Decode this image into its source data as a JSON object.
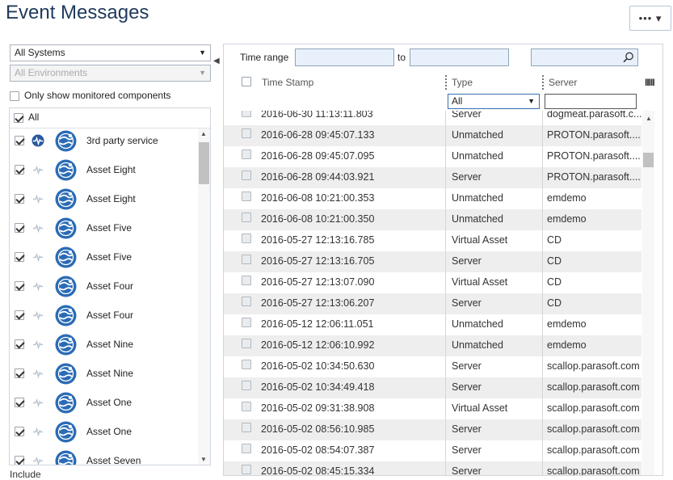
{
  "page": {
    "title": "Event Messages",
    "menu_label": "••• ▾"
  },
  "filters": {
    "systems": "All Systems",
    "environments": "All Environments",
    "only_monitored_label": "Only show monitored components"
  },
  "components": {
    "all_label": "All",
    "items": [
      {
        "label": "3rd party service",
        "checked": true,
        "active": true
      },
      {
        "label": "Asset Eight",
        "checked": true,
        "active": false
      },
      {
        "label": "Asset Eight",
        "checked": true,
        "active": false
      },
      {
        "label": "Asset Five",
        "checked": true,
        "active": false
      },
      {
        "label": "Asset Five",
        "checked": true,
        "active": false
      },
      {
        "label": "Asset Four",
        "checked": true,
        "active": false
      },
      {
        "label": "Asset Four",
        "checked": true,
        "active": false
      },
      {
        "label": "Asset Nine",
        "checked": true,
        "active": false
      },
      {
        "label": "Asset Nine",
        "checked": true,
        "active": false
      },
      {
        "label": "Asset One",
        "checked": true,
        "active": false
      },
      {
        "label": "Asset One",
        "checked": true,
        "active": false
      },
      {
        "label": "Asset Seven",
        "checked": true,
        "active": false
      }
    ],
    "include_label": "Include"
  },
  "time_range": {
    "label": "Time range",
    "to_label": "to",
    "from_value": "",
    "to_value": "",
    "search_value": ""
  },
  "grid": {
    "headers": {
      "timestamp": "Time Stamp",
      "type": "Type",
      "server": "Server"
    },
    "type_filter": "All",
    "server_filter": "",
    "columns_icon": "IIIII",
    "rows": [
      {
        "timestamp": "2016-06-30 11:13:11.803",
        "type": "Server",
        "server": "dogmeat.parasoft.c..."
      },
      {
        "timestamp": "2016-06-28 09:45:07.133",
        "type": "Unmatched",
        "server": "PROTON.parasoft...."
      },
      {
        "timestamp": "2016-06-28 09:45:07.095",
        "type": "Unmatched",
        "server": "PROTON.parasoft...."
      },
      {
        "timestamp": "2016-06-28 09:44:03.921",
        "type": "Server",
        "server": "PROTON.parasoft...."
      },
      {
        "timestamp": "2016-06-08 10:21:00.353",
        "type": "Unmatched",
        "server": "emdemo"
      },
      {
        "timestamp": "2016-06-08 10:21:00.350",
        "type": "Unmatched",
        "server": "emdemo"
      },
      {
        "timestamp": "2016-05-27 12:13:16.785",
        "type": "Virtual Asset",
        "server": "CD"
      },
      {
        "timestamp": "2016-05-27 12:13:16.705",
        "type": "Server",
        "server": "CD"
      },
      {
        "timestamp": "2016-05-27 12:13:07.090",
        "type": "Virtual Asset",
        "server": "CD"
      },
      {
        "timestamp": "2016-05-27 12:13:06.207",
        "type": "Server",
        "server": "CD"
      },
      {
        "timestamp": "2016-05-12 12:06:11.051",
        "type": "Unmatched",
        "server": "emdemo"
      },
      {
        "timestamp": "2016-05-12 12:06:10.992",
        "type": "Unmatched",
        "server": "emdemo"
      },
      {
        "timestamp": "2016-05-02 10:34:50.630",
        "type": "Server",
        "server": "scallop.parasoft.com"
      },
      {
        "timestamp": "2016-05-02 10:34:49.418",
        "type": "Server",
        "server": "scallop.parasoft.com"
      },
      {
        "timestamp": "2016-05-02 09:31:38.908",
        "type": "Virtual Asset",
        "server": "scallop.parasoft.com"
      },
      {
        "timestamp": "2016-05-02 08:56:10.985",
        "type": "Server",
        "server": "scallop.parasoft.com"
      },
      {
        "timestamp": "2016-05-02 08:54:07.387",
        "type": "Server",
        "server": "scallop.parasoft.com"
      },
      {
        "timestamp": "2016-05-02 08:45:15.334",
        "type": "Server",
        "server": "scallop.parasoft.com"
      }
    ]
  },
  "colors": {
    "accent": "#1f3a5c",
    "globe": "#2a6bb5",
    "pulse_active": "#2a5a9c",
    "pulse_inactive": "#b8c4d2",
    "row_alt": "#eeeeee"
  }
}
